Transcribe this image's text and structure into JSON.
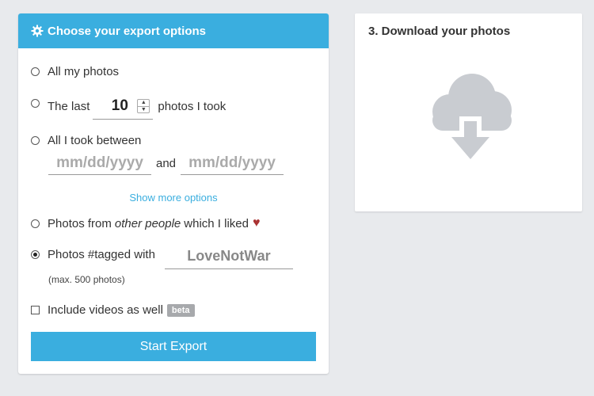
{
  "export_panel": {
    "title": "Choose your export options",
    "option_all": "All my photos",
    "option_last_prefix": "The last",
    "option_last_count": "10",
    "option_last_suffix": "photos I took",
    "option_between": "All I took between",
    "date_placeholder_from": "mm/dd/yyyy",
    "date_and": "and",
    "date_placeholder_to": "mm/dd/yyyy",
    "show_more": "Show more options",
    "option_liked_prefix": "Photos from",
    "option_liked_em": "other people",
    "option_liked_suffix": "which I liked",
    "option_tagged": "Photos #tagged with",
    "tag_value": "LoveNotWar",
    "tag_note": "(max. 500 photos)",
    "include_videos": "Include videos as well",
    "beta_badge": "beta",
    "start_button": "Start Export",
    "selected_option": "tagged"
  },
  "download_panel": {
    "title": "3. Download your photos",
    "icon": "cloud-download-icon"
  },
  "colors": {
    "accent": "#3aaedf",
    "heart": "#a33333",
    "icon_gray": "#c9ccd1"
  }
}
